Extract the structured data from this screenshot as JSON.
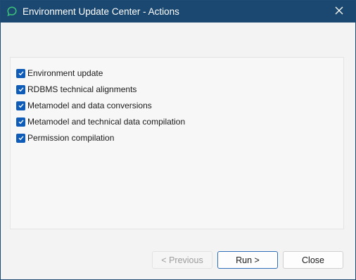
{
  "window": {
    "title": "Environment Update Center - Actions",
    "close_icon": "close-icon",
    "app_icon": "speech-bubble-icon"
  },
  "options": [
    {
      "label": "Environment update",
      "checked": true
    },
    {
      "label": "RDBMS technical alignments",
      "checked": true
    },
    {
      "label": "Metamodel and data conversions",
      "checked": true
    },
    {
      "label": "Metamodel and technical data compilation",
      "checked": true
    },
    {
      "label": "Permission compilation",
      "checked": true
    }
  ],
  "buttons": {
    "previous": "< Previous",
    "run": "Run >",
    "close": "Close"
  },
  "colors": {
    "titlebar": "#1b4870",
    "checkbox": "#0f5cb8",
    "app_icon": "#3cc37a",
    "run_border": "#2f6eb8"
  }
}
